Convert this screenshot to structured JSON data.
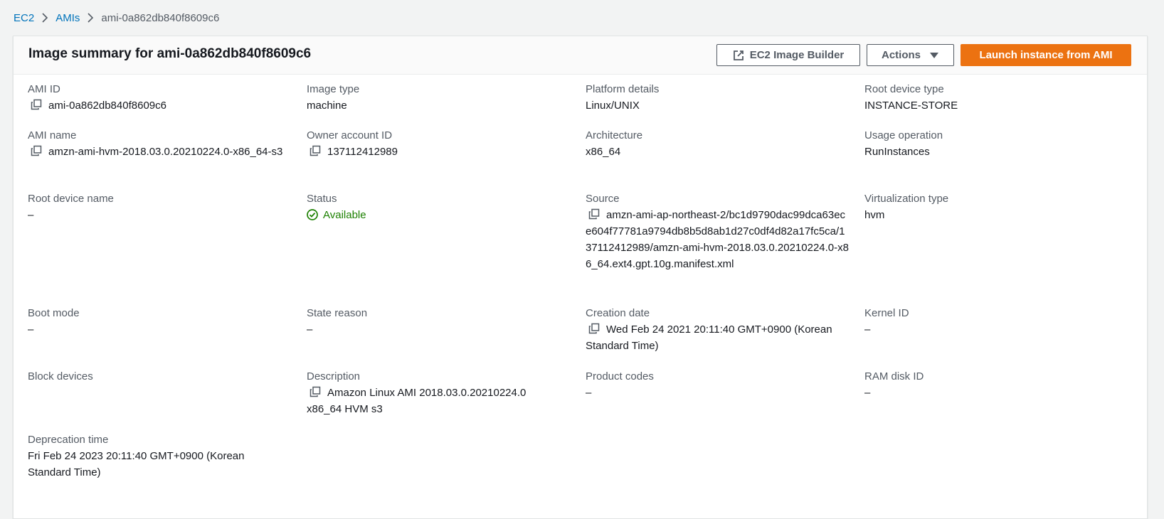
{
  "breadcrumb": {
    "items": [
      "EC2",
      "AMIs"
    ],
    "current": "ami-0a862db840f8609c6"
  },
  "header": {
    "title": "Image summary for ami-0a862db840f8609c6",
    "buttons": {
      "image_builder": "EC2 Image Builder",
      "actions": "Actions",
      "launch": "Launch instance from AMI"
    }
  },
  "colors": {
    "primary_button": "#ec7211",
    "link": "#0073bb",
    "status_ok": "#1d8102"
  },
  "details": {
    "ami_id": {
      "label": "AMI ID",
      "value": "ami-0a862db840f8609c6",
      "copyable": true
    },
    "image_type": {
      "label": "Image type",
      "value": "machine"
    },
    "platform_details": {
      "label": "Platform details",
      "value": "Linux/UNIX"
    },
    "root_device_type": {
      "label": "Root device type",
      "value": "INSTANCE-STORE"
    },
    "ami_name": {
      "label": "AMI name",
      "value": "amzn-ami-hvm-2018.03.0.20210224.0-x86_64-s3",
      "copyable": true
    },
    "owner_account_id": {
      "label": "Owner account ID",
      "value": "137112412989",
      "copyable": true
    },
    "architecture": {
      "label": "Architecture",
      "value": "x86_64"
    },
    "usage_operation": {
      "label": "Usage operation",
      "value": "RunInstances"
    },
    "root_device_name": {
      "label": "Root device name",
      "value": "–"
    },
    "status": {
      "label": "Status",
      "value": "Available",
      "icon": "check-circle-icon"
    },
    "source": {
      "label": "Source",
      "value": "amzn-ami-ap-northeast-2/bc1d9790dac99dca63ece604f77781a9794db8b5d8ab1d27c0df4d82a17fc5ca/137112412989/amzn-ami-hvm-2018.03.0.20210224.0-x86_64.ext4.gpt.10g.manifest.xml",
      "copyable": true
    },
    "virtualization_type": {
      "label": "Virtualization type",
      "value": "hvm"
    },
    "boot_mode": {
      "label": "Boot mode",
      "value": "–"
    },
    "state_reason": {
      "label": "State reason",
      "value": "–"
    },
    "creation_date": {
      "label": "Creation date",
      "value": "Wed Feb 24 2021 20:11:40 GMT+0900 (Korean Standard Time)",
      "copyable": true
    },
    "kernel_id": {
      "label": "Kernel ID",
      "value": "–"
    },
    "block_devices": {
      "label": "Block devices",
      "value": ""
    },
    "description": {
      "label": "Description",
      "value": "Amazon Linux AMI 2018.03.0.20210224.0 x86_64 HVM s3",
      "copyable": true
    },
    "product_codes": {
      "label": "Product codes",
      "value": "–"
    },
    "ram_disk_id": {
      "label": "RAM disk ID",
      "value": "–"
    },
    "deprecation_time": {
      "label": "Deprecation time",
      "value": "Fri Feb 24 2023 20:11:40 GMT+0900 (Korean Standard Time)"
    }
  }
}
